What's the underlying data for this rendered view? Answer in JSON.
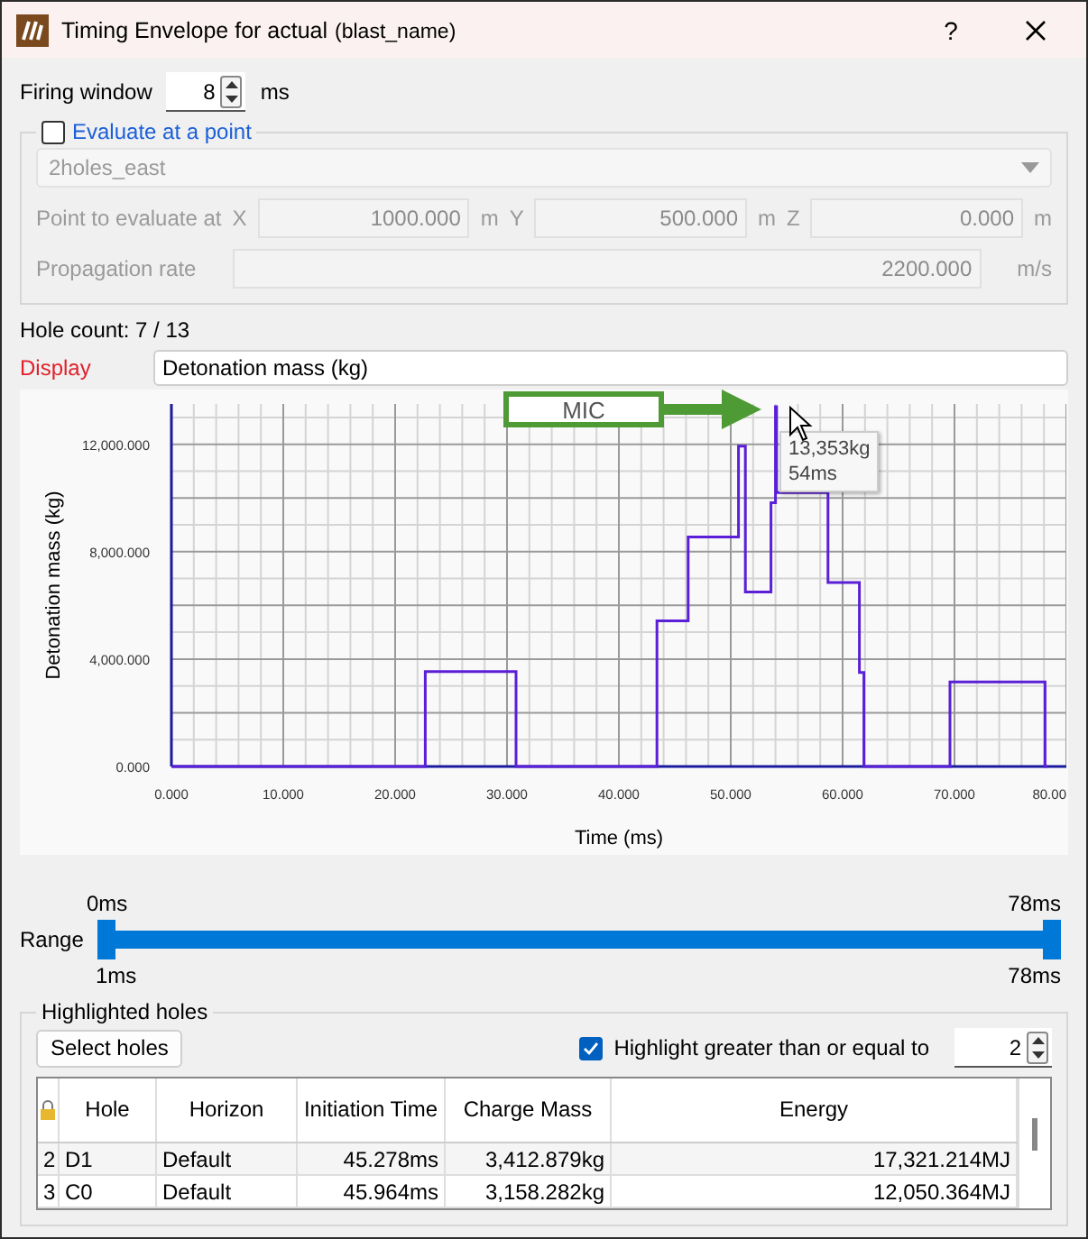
{
  "window": {
    "title": "Timing Envelope for actual",
    "subtitle": "(blast_name)",
    "help": "?"
  },
  "firing_window": {
    "label": "Firing window",
    "value": "8",
    "unit": "ms"
  },
  "evaluate_group": {
    "label": "Evaluate at a point",
    "checked": false,
    "disabled": true,
    "dropdown": {
      "value": "2holes_east"
    },
    "point": {
      "label": "Point to evaluate at",
      "fields": [
        {
          "axis": "X",
          "value": "1000.000",
          "unit": "m"
        },
        {
          "axis": "Y",
          "value": "500.000",
          "unit": "m"
        },
        {
          "axis": "Z",
          "value": "0.000",
          "unit": "m"
        }
      ]
    },
    "propagation": {
      "label": "Propagation rate",
      "value": "2200.000",
      "unit": "m/s"
    }
  },
  "hole_count": "Hole count: 7 / 13",
  "display": {
    "label": "Display",
    "value": "Detonation mass (kg)"
  },
  "chart": {
    "chart_data": {
      "type": "line",
      "xlabel": "Time (ms)",
      "ylabel": "Detonation mass (kg)",
      "xlim": [
        0,
        80
      ],
      "ylim": [
        0,
        13500
      ],
      "xticks": [
        {
          "value": 0,
          "label": "0.000"
        },
        {
          "value": 10,
          "label": "10.000"
        },
        {
          "value": 20,
          "label": "20.000"
        },
        {
          "value": 30,
          "label": "30.000"
        },
        {
          "value": 40,
          "label": "40.000"
        },
        {
          "value": 50,
          "label": "50.000"
        },
        {
          "value": 60,
          "label": "60.000"
        },
        {
          "value": 70,
          "label": "70.000"
        },
        {
          "value": 80,
          "label": "80.00"
        }
      ],
      "yticks": [
        {
          "value": 0,
          "label": "0.000"
        },
        {
          "value": 4000,
          "label": "4,000.000"
        },
        {
          "value": 8000,
          "label": "8,000.000"
        },
        {
          "value": 12000,
          "label": "12,000.000"
        }
      ],
      "x": [
        0,
        22.7,
        22.7,
        30.8,
        30.8,
        43.4,
        43.4,
        46.2,
        46.2,
        50.7,
        50.7,
        51.3,
        51.3,
        53.6,
        53.6,
        54.0,
        54.0,
        54.1,
        54.1,
        58.7,
        58.7,
        61.5,
        61.5,
        61.9,
        61.9,
        69.6,
        69.6,
        78.1,
        78.1,
        78.3
      ],
      "grid": true,
      "series": [
        {
          "color": "#5a1fd6",
          "values": [
            0,
            0,
            3530,
            3530,
            0,
            0,
            5430,
            5430,
            8550,
            8550,
            11930,
            11930,
            6500,
            6500,
            9820,
            9820,
            13400,
            13400,
            10200,
            10200,
            6850,
            6850,
            3500,
            3500,
            0,
            0,
            3150,
            3150,
            0,
            0
          ]
        }
      ]
    },
    "callout": "MIC",
    "tooltip": [
      "13,353kg",
      "54ms"
    ]
  },
  "range": {
    "label": "Range",
    "value_labels": [
      "0ms",
      "78ms"
    ],
    "limit_labels": [
      "1ms",
      "78ms"
    ],
    "low": {
      "level": 0
    },
    "high": {
      "level": 1
    }
  },
  "highlighted": {
    "label": "Highlighted holes",
    "select_button": "Select holes",
    "highlight": {
      "label": "Highlight greater than or equal to",
      "checked": true,
      "value": "2"
    },
    "table": {
      "columns": [
        "Hole",
        "Horizon",
        "Initiation Time",
        "Charge Mass",
        "Energy"
      ],
      "rows": [
        {
          "index": "2",
          "cells": [
            "D1",
            "Default",
            "45.278ms",
            "3,412.879kg",
            "17,321.214MJ"
          ]
        },
        {
          "index": "3",
          "cells": [
            "C0",
            "Default",
            "45.964ms",
            "3,158.282kg",
            "12,050.364MJ"
          ]
        }
      ]
    }
  }
}
